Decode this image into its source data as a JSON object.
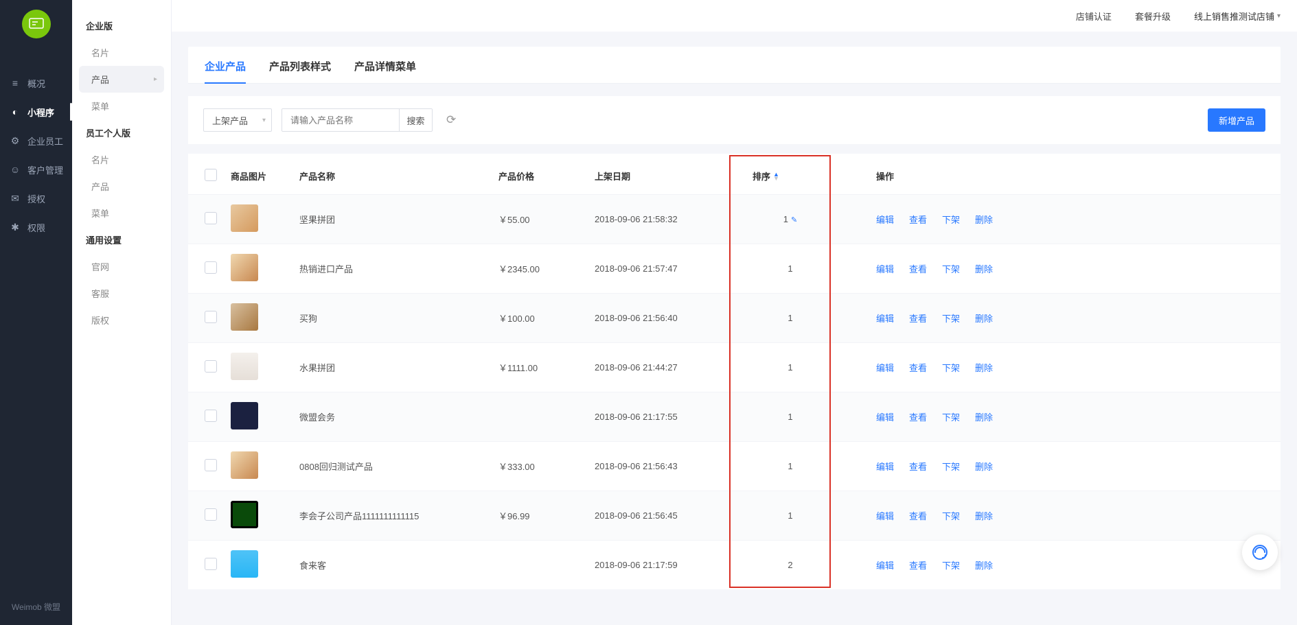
{
  "topbar": {
    "cert_label": "店铺认证",
    "upgrade_label": "套餐升级",
    "store_label": "线上销售推测试店铺"
  },
  "nav_dark": {
    "items": [
      {
        "icon": "≡",
        "label": "概况"
      },
      {
        "icon": "◐",
        "label": "小程序"
      },
      {
        "icon": "⚙",
        "label": "企业员工"
      },
      {
        "icon": "☺",
        "label": "客户管理"
      },
      {
        "icon": "✉",
        "label": "授权"
      },
      {
        "icon": "✱",
        "label": "权限"
      }
    ],
    "brand": "Weimob 微盟"
  },
  "nav_sub": {
    "groups": [
      {
        "title": "企业版",
        "items": [
          {
            "label": "名片"
          },
          {
            "label": "产品",
            "active": true
          },
          {
            "label": "菜单"
          }
        ]
      },
      {
        "title": "员工个人版",
        "items": [
          {
            "label": "名片"
          },
          {
            "label": "产品"
          },
          {
            "label": "菜单"
          }
        ]
      },
      {
        "title": "通用设置",
        "items": [
          {
            "label": "官网"
          },
          {
            "label": "客服"
          },
          {
            "label": "版权"
          }
        ]
      }
    ]
  },
  "tabs": [
    {
      "label": "企业产品",
      "active": true
    },
    {
      "label": "产品列表样式"
    },
    {
      "label": "产品详情菜单"
    }
  ],
  "filter": {
    "status_selected": "上架产品",
    "search_placeholder": "请输入产品名称",
    "search_btn": "搜索",
    "add_btn": "新增产品"
  },
  "table": {
    "headers": {
      "image": "商品图片",
      "name": "产品名称",
      "price": "产品价格",
      "date": "上架日期",
      "sort": "排序",
      "action": "操作"
    },
    "actions": {
      "edit": "编辑",
      "view": "查看",
      "off": "下架",
      "del": "删除"
    },
    "rows": [
      {
        "thumb": "th1",
        "name": "坚果拼团",
        "price": "￥55.00",
        "date": "2018-09-06 21:58:32",
        "sort": "1",
        "hovered": true
      },
      {
        "thumb": "th2",
        "name": "热销进口产品",
        "price": "￥2345.00",
        "date": "2018-09-06 21:57:47",
        "sort": "1"
      },
      {
        "thumb": "th3",
        "name": "买狗",
        "price": "￥100.00",
        "date": "2018-09-06 21:56:40",
        "sort": "1"
      },
      {
        "thumb": "th4",
        "name": "水果拼团",
        "price": "￥1111.00",
        "date": "2018-09-06 21:44:27",
        "sort": "1"
      },
      {
        "thumb": "th5",
        "name": "微盟会务",
        "price": "",
        "date": "2018-09-06 21:17:55",
        "sort": "1"
      },
      {
        "thumb": "th6",
        "name": "0808回归测试产品",
        "price": "￥333.00",
        "date": "2018-09-06 21:56:43",
        "sort": "1"
      },
      {
        "thumb": "th7",
        "name": "李会子公司产品1111111111115",
        "price": "￥96.99",
        "date": "2018-09-06 21:56:45",
        "sort": "1"
      },
      {
        "thumb": "th8",
        "name": "食来客",
        "price": "",
        "date": "2018-09-06 21:17:59",
        "sort": "2"
      }
    ]
  }
}
